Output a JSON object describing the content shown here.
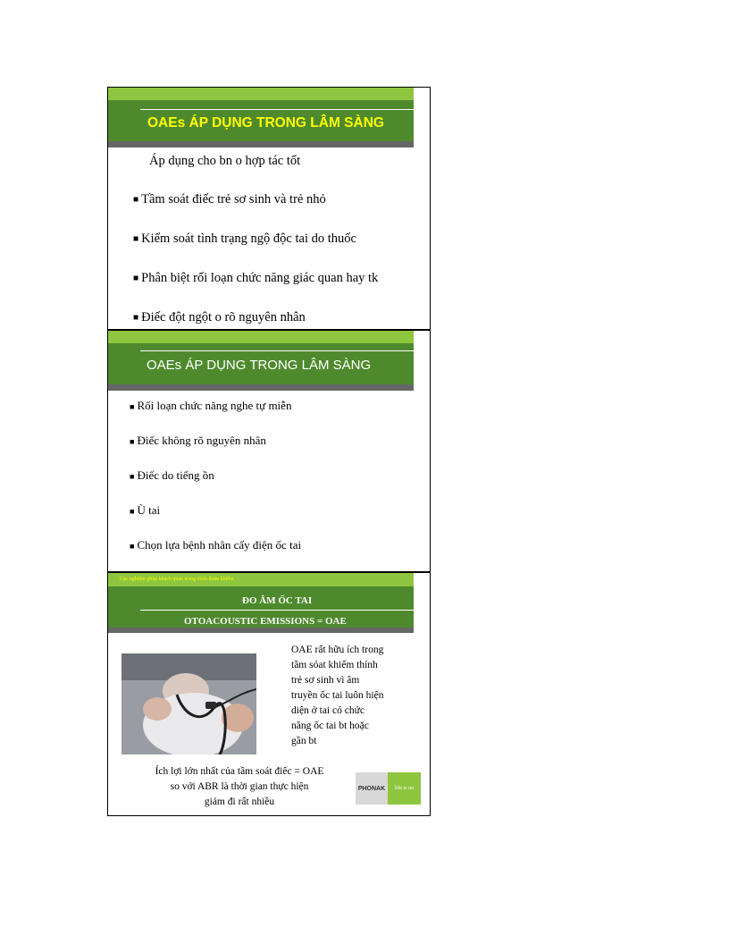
{
  "slide1": {
    "title": "OAEs ÁP DỤNG TRONG LÂM SÀNG",
    "subtitle": "Áp dụng cho bn o hợp tác tốt",
    "bullets": [
      "Tầm soát điếc trẻ sơ sinh và trẻ nhỏ",
      "Kiểm soát tình trạng ngộ độc tai do thuốc",
      "Phân biệt rối loạn chức năng giác quan hay tk",
      "Điếc đột ngột o rõ nguyên nhân"
    ]
  },
  "slide2": {
    "title": "OAEs ÁP DỤNG TRONG LÂM SÀNG",
    "bullets": [
      "Rối loạn chức năng nghe tự miễn",
      "Điếc không rõ nguyên nhân",
      "Điếc do tiếng ồn",
      "Ù tai",
      "Chọn lựa bệnh nhân cấy điện ốc tai"
    ]
  },
  "slide3": {
    "header_note": "Các nghiệm pháp khách quan trong chẩn đoán khiếm",
    "title_line1": "ĐO ÂM ỐC TAI",
    "title_line2": "OTOACOUSTIC  EMISSIONS  = OAE",
    "right_text": [
      "OAE rất hữu ích trong",
      " tầm sóat khiếm thính",
      "  trẻ sơ sinh vì âm",
      "truyền ốc tai luôn hiện",
      "diện ở tai có chức",
      "năng  ốc tai bt hoặc",
      "gần bt"
    ],
    "bottom_text": [
      "Ích lợi lớn nhất của tầm soát điếc = OAE",
      "so với ABR  là thời gian thực hiện",
      "giảm đi rất nhiều"
    ],
    "logo_left": "PHONAK",
    "logo_right": "life is on"
  },
  "colors": {
    "lime": "#8ec63f",
    "dark_green": "#4e8a2d",
    "title_yellow": "#ffff00"
  }
}
